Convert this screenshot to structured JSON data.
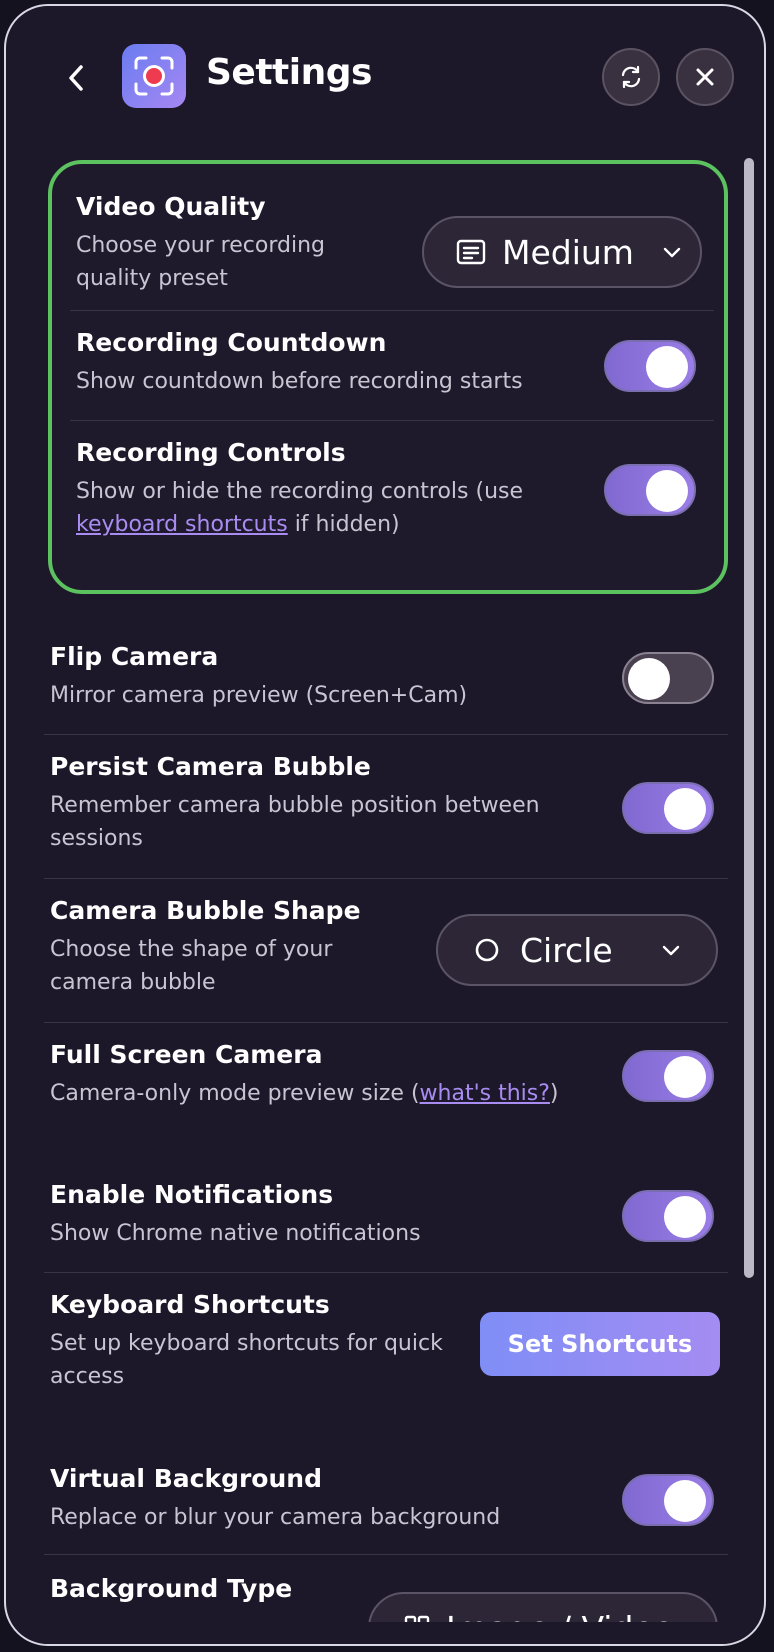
{
  "header": {
    "title": "Settings",
    "back_icon": "chevron-left-icon",
    "app_icon": "record-icon",
    "refresh_icon": "refresh-icon",
    "close_icon": "close-icon"
  },
  "colors": {
    "accent": "#9a7de6",
    "card_border": "#5cc25f",
    "link": "#a98cf2",
    "background": "#1d1829"
  },
  "highlighted_card": {
    "video_quality": {
      "title": "Video Quality",
      "desc_line1": "Choose your recording",
      "desc_line2": "quality preset",
      "value": "Medium"
    },
    "recording_countdown": {
      "title": "Recording Countdown",
      "desc": "Show countdown before recording starts",
      "enabled": true
    },
    "recording_controls": {
      "title": "Recording Controls",
      "desc_line1": "Show or hide the recording controls (use",
      "link": "keyboard shortcuts",
      "desc_tail": " if hidden)",
      "enabled": true
    }
  },
  "settings": {
    "flip_camera": {
      "title": "Flip Camera",
      "desc": "Mirror camera preview (Screen+Cam)",
      "enabled": false
    },
    "persist_bubble": {
      "title": "Persist Camera Bubble",
      "desc_line1": "Remember camera bubble position between",
      "desc_line2": "sessions",
      "enabled": true
    },
    "bubble_shape": {
      "title": "Camera Bubble Shape",
      "desc_line1": "Choose the shape of your",
      "desc_line2": "camera bubble",
      "value": "Circle"
    },
    "full_screen_camera": {
      "title": "Full Screen Camera",
      "desc_prefix": "Camera-only mode preview size (",
      "link": "what's this?",
      "desc_suffix": ")",
      "enabled": true
    },
    "notifications": {
      "title": "Enable Notifications",
      "desc": "Show Chrome native notifications",
      "enabled": true
    },
    "keyboard_shortcuts": {
      "title": "Keyboard Shortcuts",
      "desc_line1": "Set up keyboard shortcuts for quick",
      "desc_line2": "access",
      "button": "Set Shortcuts"
    },
    "virtual_background": {
      "title": "Virtual Background",
      "desc": "Replace or blur your camera background",
      "enabled": true
    },
    "background_type": {
      "title": "Background Type",
      "value": "Image / Video"
    }
  }
}
